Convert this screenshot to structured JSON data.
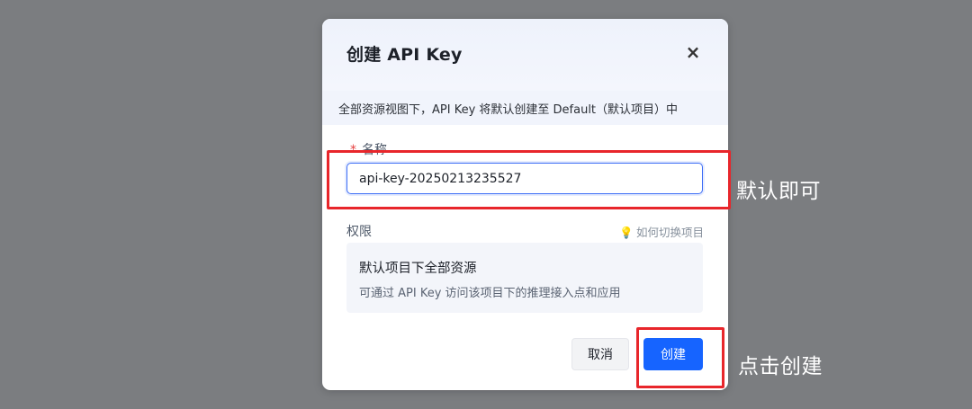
{
  "dialog": {
    "title": "创建 API Key",
    "close_glyph": "×",
    "notice": "全部资源视图下，API Key 将默认创建至 Default（默认项目）中",
    "name_field": {
      "required_mark": "*",
      "label": "名称",
      "value": "api-key-20250213235527"
    },
    "permissions": {
      "label": "权限",
      "switch_link_icon": "lightbulb-icon",
      "switch_link": "如何切换项目",
      "card_title": "默认项目下全部资源",
      "card_desc": "可通过 API Key 访问该项目下的推理接入点和应用"
    },
    "buttons": {
      "cancel": "取消",
      "create": "创建"
    }
  },
  "annotations": {
    "default_ok": "默认即可",
    "click_create": "点击创建"
  },
  "colors": {
    "backdrop": "#7b7d80",
    "primary": "#1664ff",
    "highlight": "#e8262b",
    "required": "#e53e3e"
  }
}
